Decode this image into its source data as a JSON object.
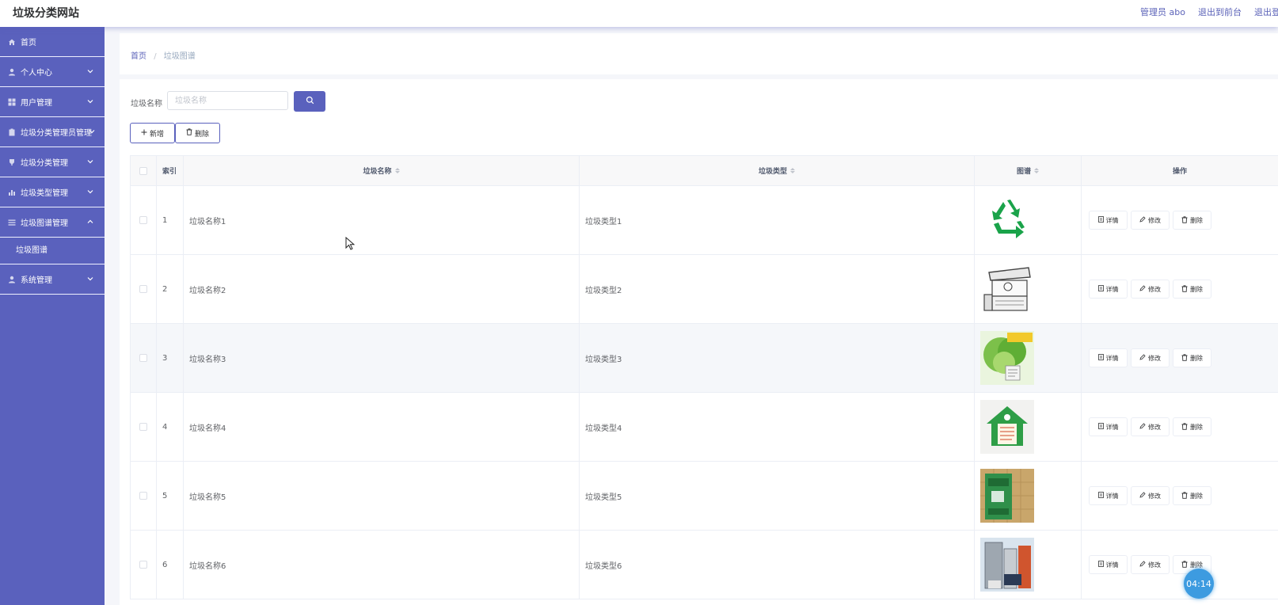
{
  "header": {
    "title": "垃圾分类网站",
    "user_label": "管理员 abo",
    "to_front": "退出到前台",
    "logout": "退出登录"
  },
  "sidebar": {
    "items": [
      {
        "label": "首页",
        "icon": "home-icon"
      },
      {
        "label": "个人中心",
        "icon": "user-icon"
      },
      {
        "label": "用户管理",
        "icon": "grid-icon"
      },
      {
        "label": "垃圾分类管理员管理",
        "icon": "clipboard-icon"
      },
      {
        "label": "垃圾分类管理",
        "icon": "trophy-icon"
      },
      {
        "label": "垃圾类型管理",
        "icon": "chart-icon"
      },
      {
        "label": "垃圾图谱管理",
        "icon": "list-icon"
      },
      {
        "label": "系统管理",
        "icon": "user-icon"
      }
    ],
    "sub_items": [
      {
        "label": "垃圾图谱"
      }
    ]
  },
  "breadcrumb": {
    "home": "首页",
    "separator": "/",
    "current": "垃圾图谱"
  },
  "search": {
    "label": "垃圾名称",
    "placeholder": "垃圾名称"
  },
  "actions": {
    "add_label": "新增",
    "delete_label": "删除"
  },
  "table": {
    "headers": {
      "index": "索引",
      "name": "垃圾名称",
      "type": "垃圾类型",
      "image": "图谱",
      "ops": "操作"
    },
    "op_labels": {
      "detail": "详情",
      "edit": "修改",
      "delete": "删除"
    },
    "rows": [
      {
        "index": "1",
        "name": "垃圾名称1",
        "type": "垃圾类型1",
        "image": "recycle-symbol"
      },
      {
        "index": "2",
        "name": "垃圾名称2",
        "type": "垃圾类型2",
        "image": "sketch-kiosk"
      },
      {
        "index": "3",
        "name": "垃圾名称3",
        "type": "垃圾类型3",
        "image": "green-leaf-poster"
      },
      {
        "index": "4",
        "name": "垃圾名称4",
        "type": "垃圾类型4",
        "image": "house-sign"
      },
      {
        "index": "5",
        "name": "垃圾名称5",
        "type": "垃圾类型5",
        "image": "green-bin"
      },
      {
        "index": "6",
        "name": "垃圾名称6",
        "type": "垃圾类型6",
        "image": "appliances"
      }
    ]
  },
  "timer": "04:14",
  "colors": {
    "accent": "#5a61bd",
    "header_link": "#5b62b8",
    "timer": "#3d9be0"
  }
}
